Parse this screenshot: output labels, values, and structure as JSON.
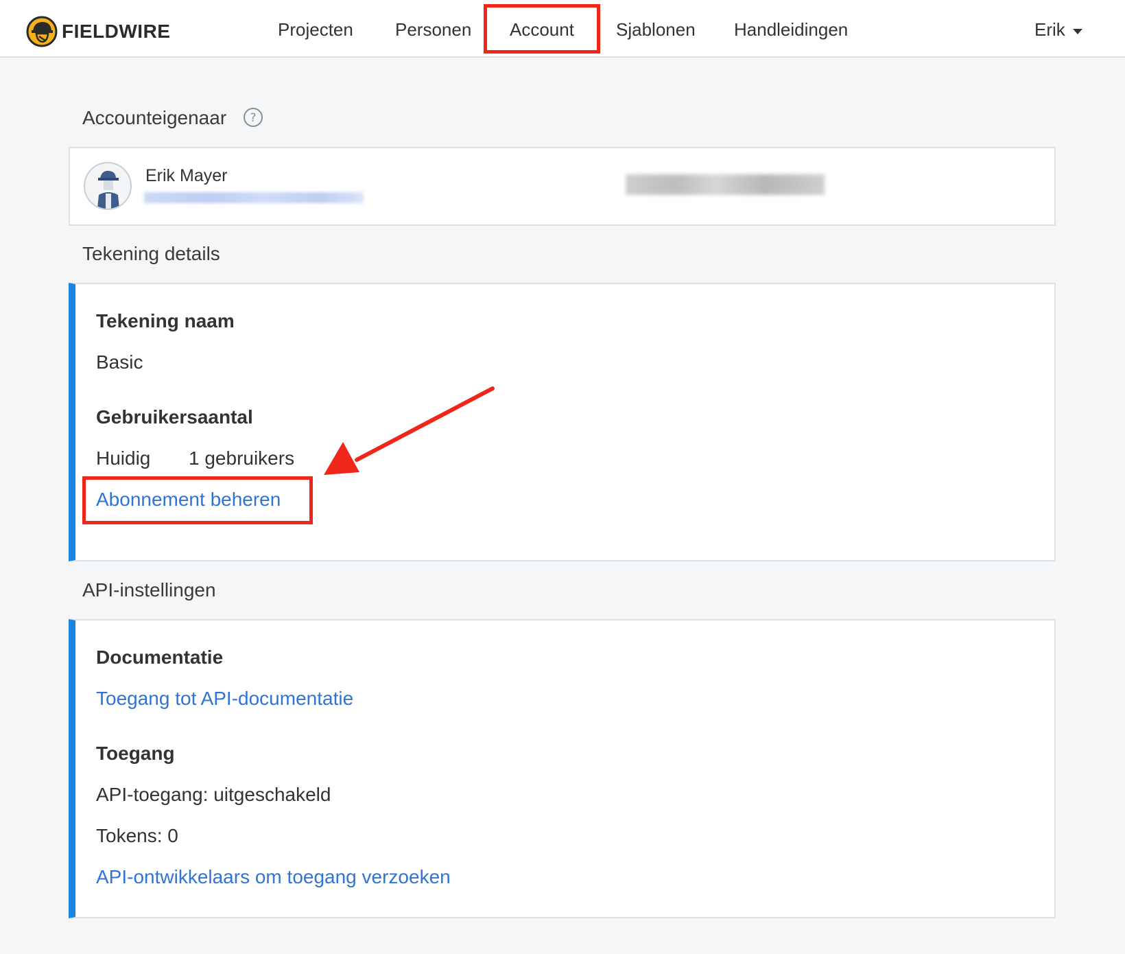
{
  "app": {
    "brand": "FIELDWIRE",
    "accent_color": "#1b86e0",
    "link_color": "#2f74d6",
    "annotation_color": "#f0261a"
  },
  "nav": {
    "items": [
      {
        "label": "Projecten"
      },
      {
        "label": "Personen"
      },
      {
        "label": "Account",
        "active": true
      },
      {
        "label": "Sjablonen"
      },
      {
        "label": "Handleidingen"
      }
    ],
    "user_label": "Erik"
  },
  "owner": {
    "section_title": "Accounteigenaar",
    "help_icon": "question-circle-icon",
    "name": "Erik Mayer"
  },
  "plan": {
    "section_title": "Tekening details",
    "name_label": "Tekening naam",
    "name_value": "Basic",
    "user_count_label": "Gebruikersaantal",
    "current_label": "Huidig",
    "current_value": "1 gebruikers",
    "manage_link": "Abonnement beheren"
  },
  "api": {
    "section_title": "API-instellingen",
    "docs_label": "Documentatie",
    "docs_link": "Toegang tot API-documentatie",
    "access_label": "Toegang",
    "access_status": "API-toegang: uitgeschakeld",
    "tokens": "Tokens: 0",
    "request_link": "API-ontwikkelaars om toegang verzoeken"
  }
}
